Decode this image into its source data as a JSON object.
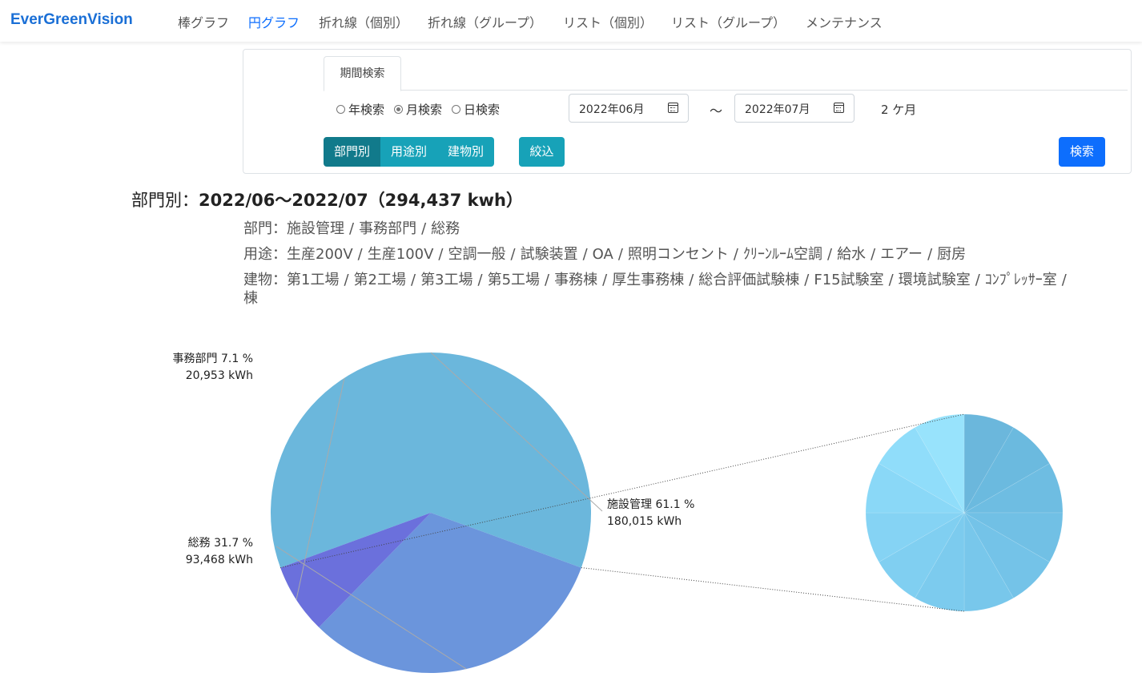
{
  "header": {
    "brand": "EverGreenVision",
    "nav": [
      {
        "label": "棒グラフ",
        "active": false
      },
      {
        "label": "円グラフ",
        "active": true
      },
      {
        "label": "折れ線（個別）",
        "active": false
      },
      {
        "label": "折れ線（グループ）",
        "active": false
      },
      {
        "label": "リスト（個別）",
        "active": false
      },
      {
        "label": "リスト（グループ）",
        "active": false
      },
      {
        "label": "メンテナンス",
        "active": false
      }
    ]
  },
  "search": {
    "tab_label": "期間検索",
    "radio_options": [
      {
        "label": "年検索",
        "checked": false
      },
      {
        "label": "月検索",
        "checked": true
      },
      {
        "label": "日検索",
        "checked": false
      }
    ],
    "date_from": "2022年06月",
    "date_to": "2022年07月",
    "range_separator": "～",
    "months_label": "2 ケ月",
    "group_buttons": [
      {
        "label": "部門別",
        "active": true
      },
      {
        "label": "用途別",
        "active": false
      },
      {
        "label": "建物別",
        "active": false
      }
    ],
    "filter_button": "絞込",
    "search_button": "検索"
  },
  "summary": {
    "title_prefix": "部門別：",
    "title_period": "2022/06～2022/07（294,437 kwh）",
    "filters": [
      {
        "label": "部門：",
        "items": [
          "施設管理",
          "事務部門",
          "総務"
        ]
      },
      {
        "label": "用途：",
        "items": [
          "生産200V",
          "生産100V",
          "空調一般",
          "試験装置",
          "OA",
          "照明コンセント",
          "ｸﾘｰﾝﾙｰﾑ空調",
          "給水",
          "エアー",
          "厨房"
        ]
      },
      {
        "label": "建物：",
        "items": [
          "第1工場",
          "第2工場",
          "第3工場",
          "第5工場",
          "事務棟",
          "厚生事務棟",
          "総合評価試験棟",
          "F15試験室",
          "環境試験室",
          "ｺﾝﾌﾟﾚｯｻｰ室"
        ]
      }
    ],
    "building_wrap_tail": "棟"
  },
  "chart_data": {
    "type": "pie",
    "slices": [
      {
        "name": "施設管理",
        "percent": 61.1,
        "value": 180015,
        "value_label": "180,015 kWh",
        "color": "#6bb7dc"
      },
      {
        "name": "総務",
        "percent": 31.7,
        "value": 93468,
        "value_label": "93,468 kWh",
        "color": "#6b95dc"
      },
      {
        "name": "事務部門",
        "percent": 7.1,
        "value": 20953,
        "value_label": "20,953 kWh",
        "color": "#6b70dc"
      }
    ],
    "breakdown_of": "施設管理",
    "breakdown_colors": [
      "#6bb7dc",
      "#6bbadf",
      "#6ebde2",
      "#71c0e5",
      "#74c3e8",
      "#78c7eb",
      "#7ccbee",
      "#80cff1",
      "#85d3f4",
      "#8ad8f7",
      "#90ddfa",
      "#98e3fc"
    ],
    "unit": "kWh"
  }
}
